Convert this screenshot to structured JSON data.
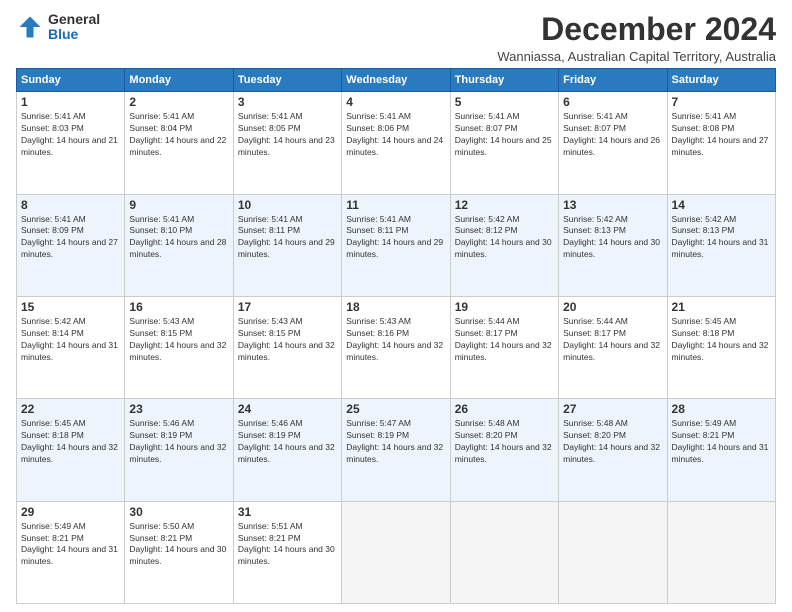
{
  "logo": {
    "general": "General",
    "blue": "Blue"
  },
  "header": {
    "title": "December 2024",
    "subtitle": "Wanniassa, Australian Capital Territory, Australia"
  },
  "weekdays": [
    "Sunday",
    "Monday",
    "Tuesday",
    "Wednesday",
    "Thursday",
    "Friday",
    "Saturday"
  ],
  "weeks": [
    [
      {
        "day": "1",
        "sunrise": "5:41 AM",
        "sunset": "8:03 PM",
        "daylight": "14 hours and 21 minutes."
      },
      {
        "day": "2",
        "sunrise": "5:41 AM",
        "sunset": "8:04 PM",
        "daylight": "14 hours and 22 minutes."
      },
      {
        "day": "3",
        "sunrise": "5:41 AM",
        "sunset": "8:05 PM",
        "daylight": "14 hours and 23 minutes."
      },
      {
        "day": "4",
        "sunrise": "5:41 AM",
        "sunset": "8:06 PM",
        "daylight": "14 hours and 24 minutes."
      },
      {
        "day": "5",
        "sunrise": "5:41 AM",
        "sunset": "8:07 PM",
        "daylight": "14 hours and 25 minutes."
      },
      {
        "day": "6",
        "sunrise": "5:41 AM",
        "sunset": "8:07 PM",
        "daylight": "14 hours and 26 minutes."
      },
      {
        "day": "7",
        "sunrise": "5:41 AM",
        "sunset": "8:08 PM",
        "daylight": "14 hours and 27 minutes."
      }
    ],
    [
      {
        "day": "8",
        "sunrise": "5:41 AM",
        "sunset": "8:09 PM",
        "daylight": "14 hours and 27 minutes."
      },
      {
        "day": "9",
        "sunrise": "5:41 AM",
        "sunset": "8:10 PM",
        "daylight": "14 hours and 28 minutes."
      },
      {
        "day": "10",
        "sunrise": "5:41 AM",
        "sunset": "8:11 PM",
        "daylight": "14 hours and 29 minutes."
      },
      {
        "day": "11",
        "sunrise": "5:41 AM",
        "sunset": "8:11 PM",
        "daylight": "14 hours and 29 minutes."
      },
      {
        "day": "12",
        "sunrise": "5:42 AM",
        "sunset": "8:12 PM",
        "daylight": "14 hours and 30 minutes."
      },
      {
        "day": "13",
        "sunrise": "5:42 AM",
        "sunset": "8:13 PM",
        "daylight": "14 hours and 30 minutes."
      },
      {
        "day": "14",
        "sunrise": "5:42 AM",
        "sunset": "8:13 PM",
        "daylight": "14 hours and 31 minutes."
      }
    ],
    [
      {
        "day": "15",
        "sunrise": "5:42 AM",
        "sunset": "8:14 PM",
        "daylight": "14 hours and 31 minutes."
      },
      {
        "day": "16",
        "sunrise": "5:43 AM",
        "sunset": "8:15 PM",
        "daylight": "14 hours and 32 minutes."
      },
      {
        "day": "17",
        "sunrise": "5:43 AM",
        "sunset": "8:15 PM",
        "daylight": "14 hours and 32 minutes."
      },
      {
        "day": "18",
        "sunrise": "5:43 AM",
        "sunset": "8:16 PM",
        "daylight": "14 hours and 32 minutes."
      },
      {
        "day": "19",
        "sunrise": "5:44 AM",
        "sunset": "8:17 PM",
        "daylight": "14 hours and 32 minutes."
      },
      {
        "day": "20",
        "sunrise": "5:44 AM",
        "sunset": "8:17 PM",
        "daylight": "14 hours and 32 minutes."
      },
      {
        "day": "21",
        "sunrise": "5:45 AM",
        "sunset": "8:18 PM",
        "daylight": "14 hours and 32 minutes."
      }
    ],
    [
      {
        "day": "22",
        "sunrise": "5:45 AM",
        "sunset": "8:18 PM",
        "daylight": "14 hours and 32 minutes."
      },
      {
        "day": "23",
        "sunrise": "5:46 AM",
        "sunset": "8:19 PM",
        "daylight": "14 hours and 32 minutes."
      },
      {
        "day": "24",
        "sunrise": "5:46 AM",
        "sunset": "8:19 PM",
        "daylight": "14 hours and 32 minutes."
      },
      {
        "day": "25",
        "sunrise": "5:47 AM",
        "sunset": "8:19 PM",
        "daylight": "14 hours and 32 minutes."
      },
      {
        "day": "26",
        "sunrise": "5:48 AM",
        "sunset": "8:20 PM",
        "daylight": "14 hours and 32 minutes."
      },
      {
        "day": "27",
        "sunrise": "5:48 AM",
        "sunset": "8:20 PM",
        "daylight": "14 hours and 32 minutes."
      },
      {
        "day": "28",
        "sunrise": "5:49 AM",
        "sunset": "8:21 PM",
        "daylight": "14 hours and 31 minutes."
      }
    ],
    [
      {
        "day": "29",
        "sunrise": "5:49 AM",
        "sunset": "8:21 PM",
        "daylight": "14 hours and 31 minutes."
      },
      {
        "day": "30",
        "sunrise": "5:50 AM",
        "sunset": "8:21 PM",
        "daylight": "14 hours and 30 minutes."
      },
      {
        "day": "31",
        "sunrise": "5:51 AM",
        "sunset": "8:21 PM",
        "daylight": "14 hours and 30 minutes."
      },
      null,
      null,
      null,
      null
    ]
  ]
}
